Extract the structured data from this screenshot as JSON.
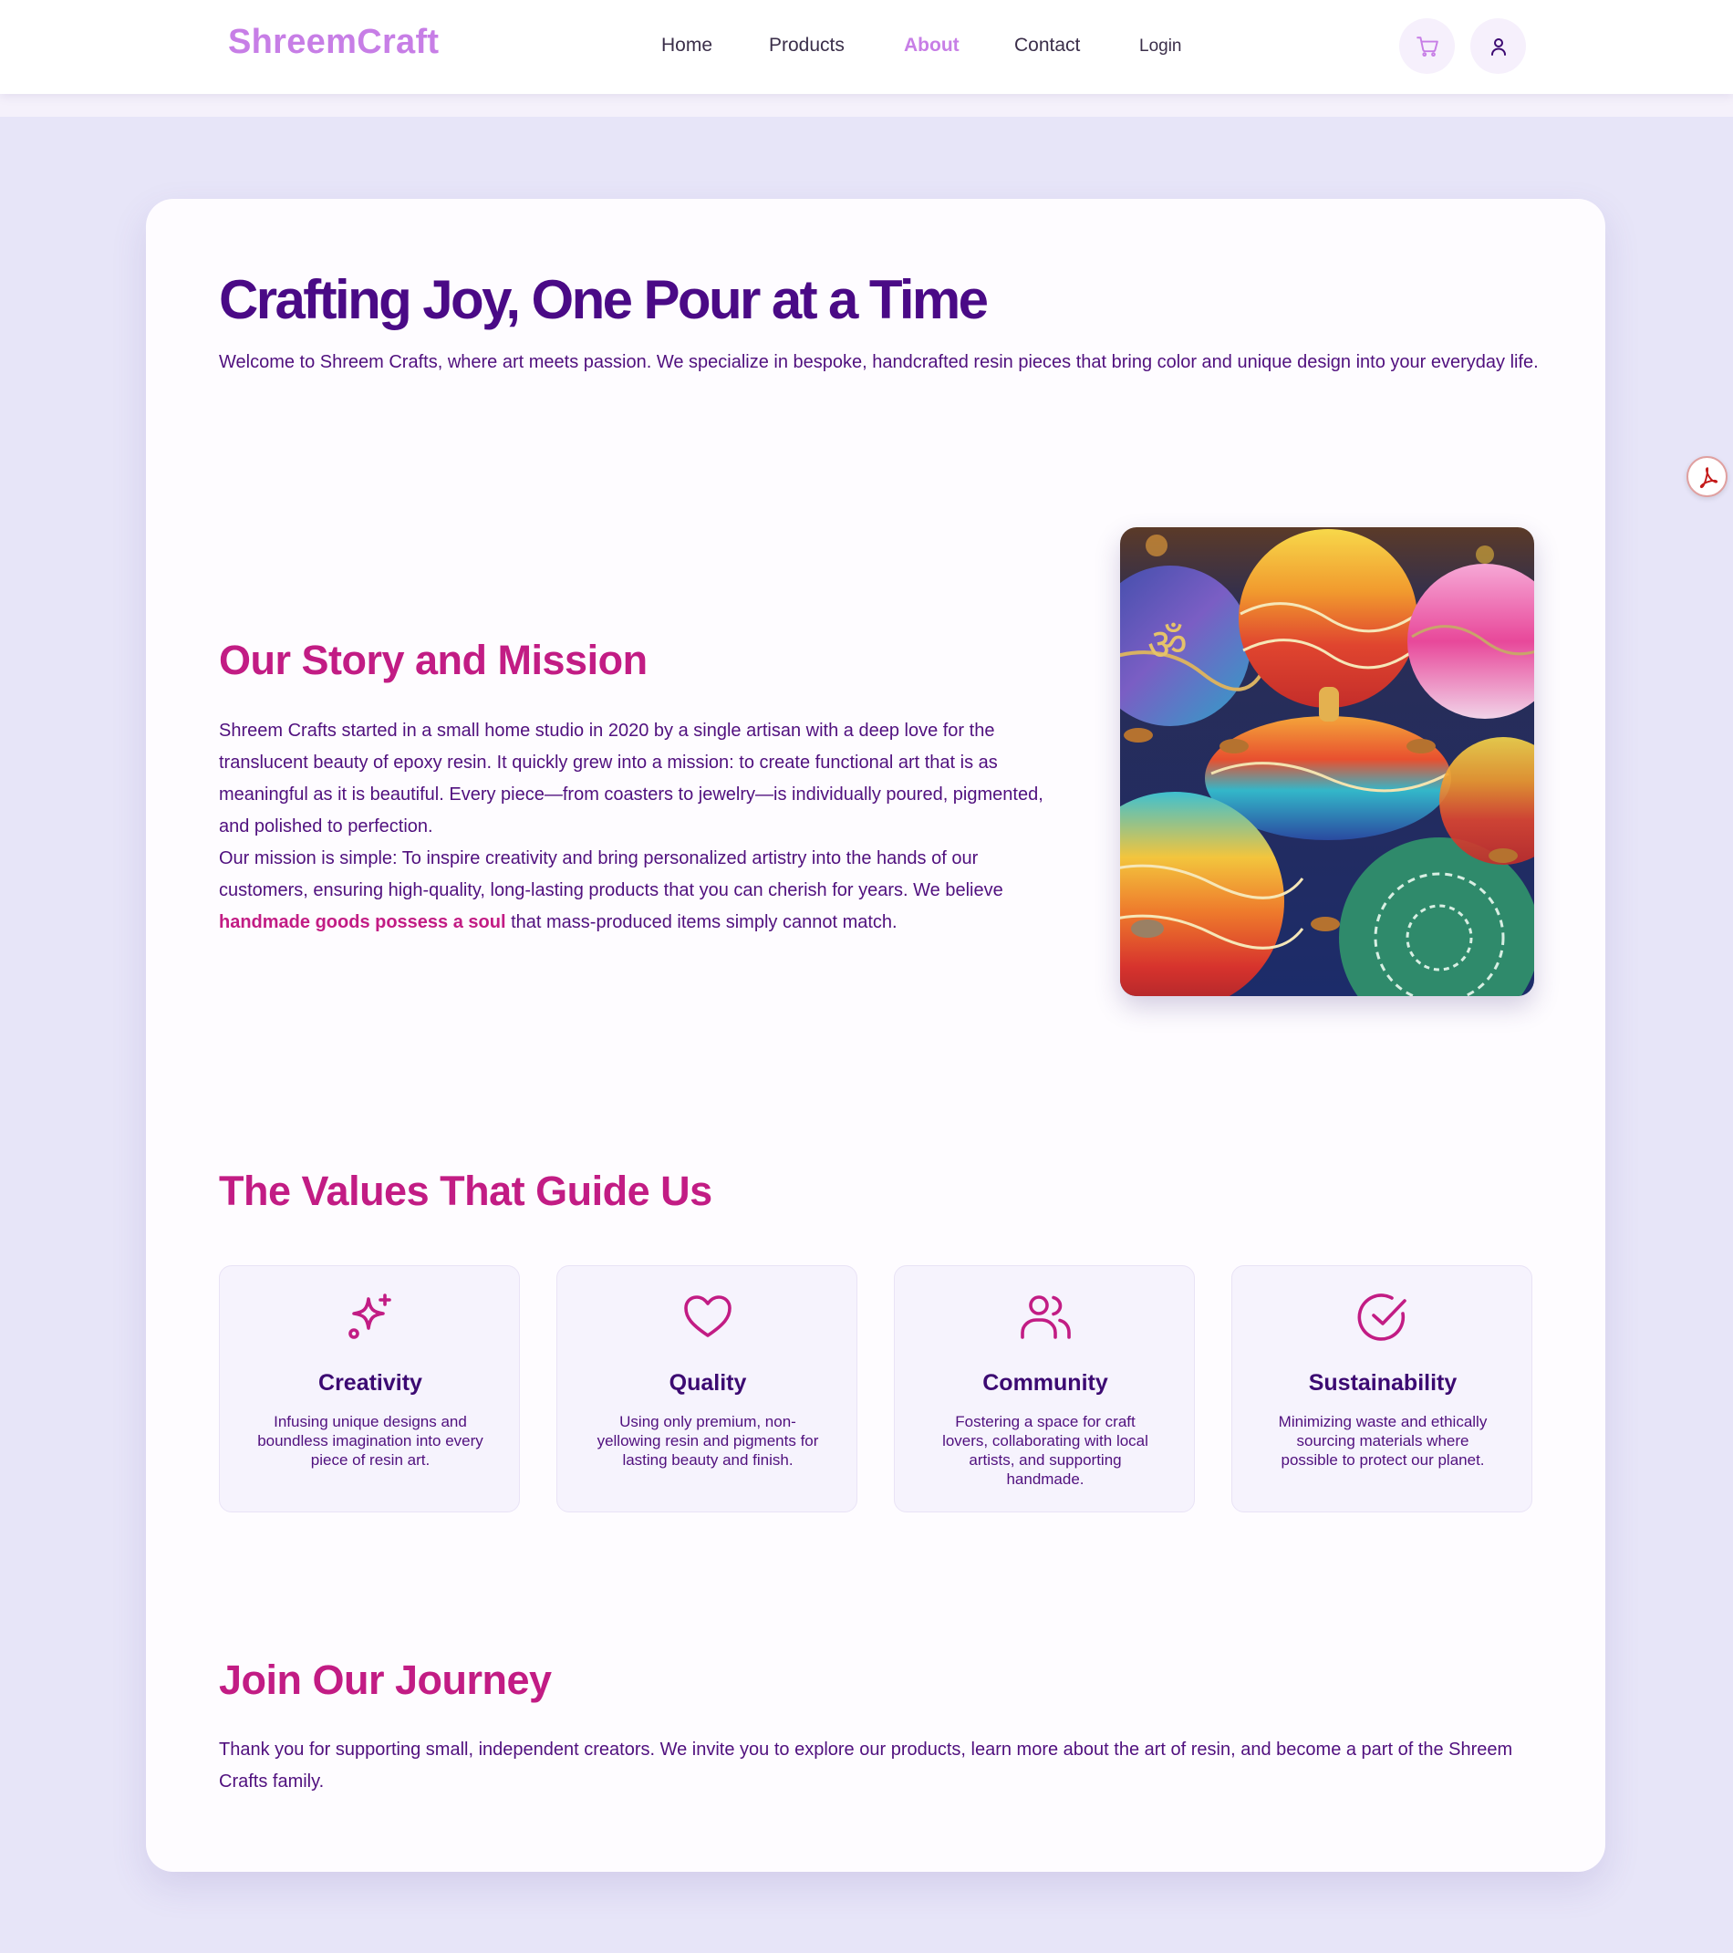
{
  "brand": {
    "name": "ShreemCraft",
    "color": "#c77ee6"
  },
  "nav": {
    "items": [
      {
        "label": "Home",
        "active": false
      },
      {
        "label": "Products",
        "active": false
      },
      {
        "label": "About",
        "active": true
      },
      {
        "label": "Contact",
        "active": false
      }
    ],
    "login_label": "Login",
    "cart_icon": "cart-icon",
    "account_icon": "user-icon"
  },
  "hero": {
    "title": "Crafting Joy, One Pour at a Time",
    "subtitle": "Welcome to Shreem Crafts, where art meets passion. We specialize in bespoke, handcrafted resin pieces that bring color and unique design into your everyday life."
  },
  "story": {
    "title": "Our Story and Mission",
    "paragraph1": "Shreem Crafts started in a small home studio in 2020 by a single artisan with a deep love for the translucent beauty of epoxy resin. It quickly grew into a mission: to create functional art that is as meaningful as it is beautiful. Every piece—from coasters to jewelry—is individually poured, pigmented, and polished to perfection.",
    "paragraph2_before": "Our mission is simple: To inspire creativity and bring personalized artistry into the hands of our customers, ensuring high-quality, long-lasting products that you can cherish for years. We believe ",
    "paragraph2_highlight": "handmade goods possess a soul",
    "paragraph2_after": " that mass-produced items simply cannot match."
  },
  "values": {
    "title": "The Values That Guide Us",
    "items": [
      {
        "icon": "sparkles-icon",
        "title": "Creativity",
        "description": "Infusing unique designs and boundless imagination into every piece of resin art."
      },
      {
        "icon": "heart-icon",
        "title": "Quality",
        "description": "Using only premium, non-yellowing resin and pigments for lasting beauty and finish."
      },
      {
        "icon": "users-icon",
        "title": "Community",
        "description": "Fostering a space for craft lovers, collaborating with local artists, and supporting handmade."
      },
      {
        "icon": "check-circle-icon",
        "title": "Sustainability",
        "description": "Minimizing waste and ethically sourcing materials where possible to protect our planet."
      }
    ]
  },
  "journey": {
    "title": "Join Our Journey",
    "text": "Thank you for supporting small, independent creators. We invite you to explore our products, learn more about the art of resin, and become a part of the Shreem Crafts family."
  },
  "colors": {
    "page_bg": "#e7e5f8",
    "heading_dark": "#4a0a86",
    "heading_accent": "#c21c84",
    "body_text": "#50107e"
  }
}
